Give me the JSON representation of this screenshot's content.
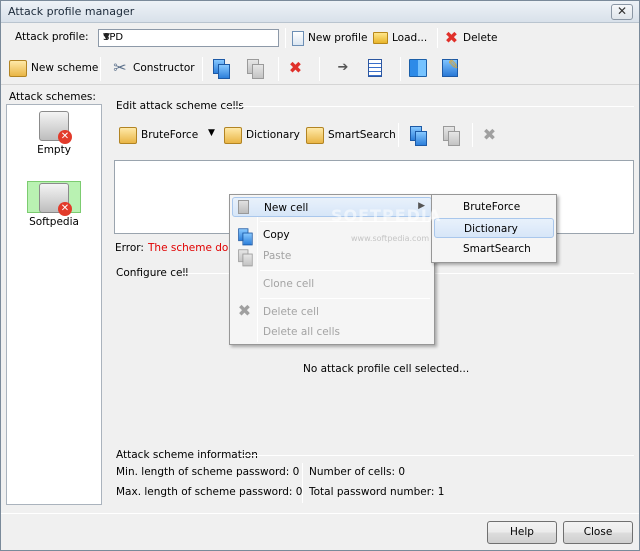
{
  "window": {
    "title": "Attack profile manager",
    "close_glyph": "✕"
  },
  "toolbar1": {
    "profile_label": "Attack profile:",
    "profile_value": "SPD",
    "new_profile": "New profile",
    "load": "Load...",
    "delete": "Delete"
  },
  "toolbar2": {
    "new_scheme": "New scheme",
    "constructor": "Constructor"
  },
  "left": {
    "header": "Attack schemes:",
    "items": [
      {
        "label": "Empty",
        "selected": false
      },
      {
        "label": "Softpedia",
        "selected": true
      }
    ]
  },
  "edit_cells": {
    "title": "Edit attack scheme cells",
    "bruteforce": "BruteForce",
    "dictionary": "Dictionary",
    "smartsearch": "SmartSearch",
    "error_label": "Error:",
    "error_text": "The scheme does"
  },
  "configure": {
    "title": "Configure cell",
    "empty_text": "No attack profile cell selected..."
  },
  "info": {
    "title": "Attack scheme information",
    "min_len": "Min. length of scheme password: 0",
    "max_len": "Max. length of scheme password: 0",
    "num_cells": "Number of cells: 0",
    "total": "Total password number: 1"
  },
  "buttons": {
    "help": "Help",
    "close": "Close"
  },
  "context_menu": {
    "new_cell": "New cell",
    "copy": "Copy",
    "paste": "Paste",
    "clone": "Clone cell",
    "delete_cell": "Delete cell",
    "delete_all": "Delete all cells"
  },
  "submenu": {
    "items": [
      "BruteForce",
      "Dictionary",
      "SmartSearch"
    ],
    "highlighted": "Dictionary"
  },
  "watermark": {
    "main": "SOFTPEDIA",
    "sub": "www.softpedia.com"
  },
  "colors": {
    "error": "#e00000",
    "selected_scheme": "#b9f2b2",
    "menu_highlight": "#d7e6f8"
  }
}
